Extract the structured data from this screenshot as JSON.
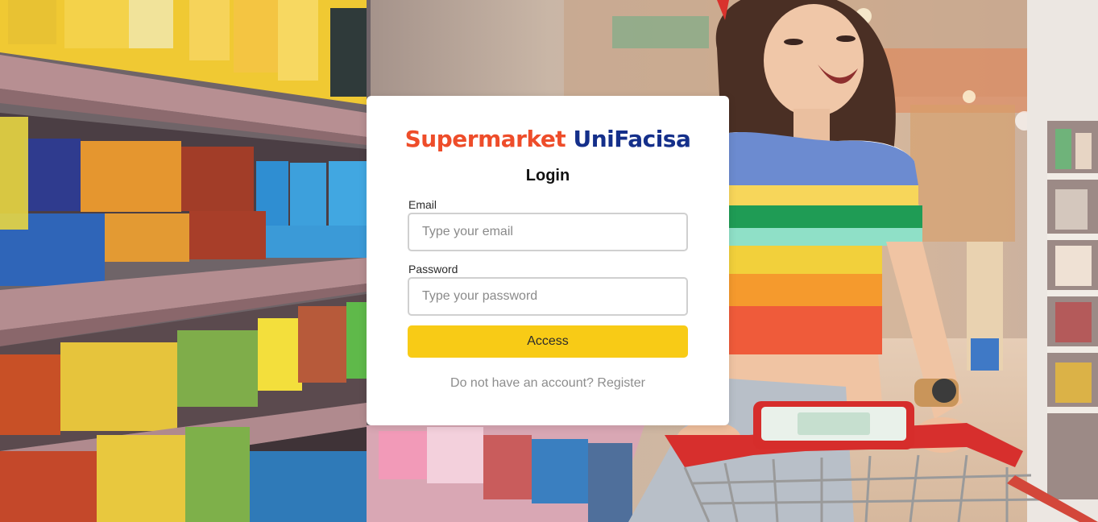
{
  "brand": {
    "part1": "Supermarket",
    "part2": "UniFacisa",
    "color1": "#ee4d2a",
    "color2": "#142f8a"
  },
  "login": {
    "title": "Login",
    "email_label": "Email",
    "email_placeholder": "Type your email",
    "password_label": "Password",
    "password_placeholder": "Type your password",
    "access_label": "Access",
    "register_text": "Do not have an account? Register",
    "accent": "#f8cb16"
  },
  "background": {
    "subject": "supermarket-aisle-shopper-photo"
  }
}
